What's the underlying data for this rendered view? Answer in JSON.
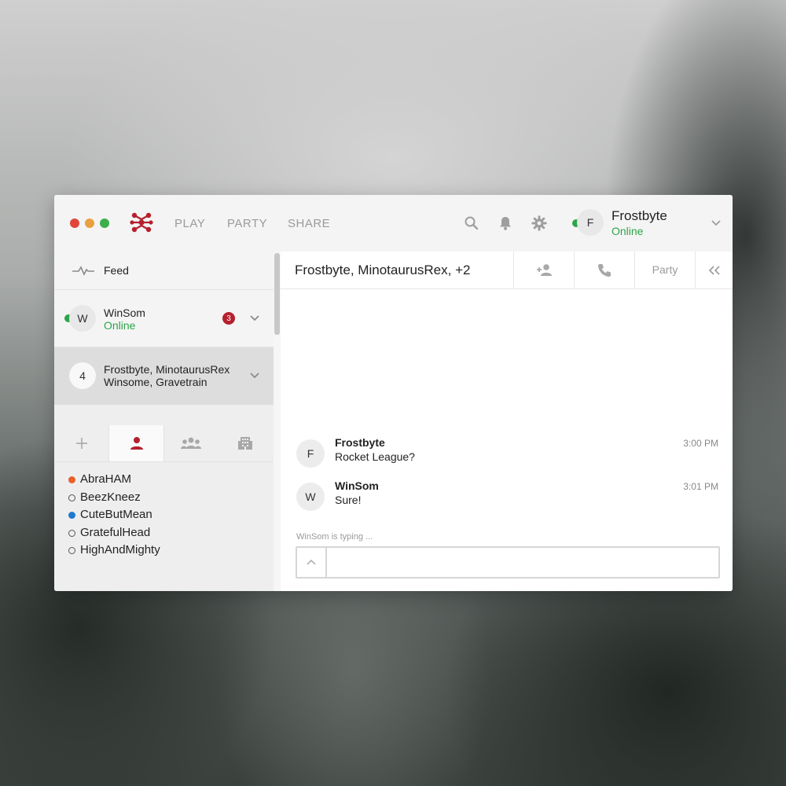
{
  "topbar": {
    "nav": {
      "play": "PLAY",
      "party": "PARTY",
      "share": "SHARE"
    },
    "profile": {
      "initial": "F",
      "name": "Frostbyte",
      "status": "Online"
    }
  },
  "sidebar": {
    "feed_label": "Feed",
    "conversations": [
      {
        "initial": "W",
        "name": "WinSom",
        "status": "Online",
        "unread": "3"
      },
      {
        "count": "4",
        "line1": "Frostbyte, MinotaurusRex",
        "line2": "Winsome, Gravetrain"
      }
    ],
    "tabs": [
      {
        "icon": "plus-icon"
      },
      {
        "icon": "person-icon",
        "active": true
      },
      {
        "icon": "group-icon"
      },
      {
        "icon": "building-icon"
      }
    ],
    "friends": [
      {
        "name": "AbraHAM",
        "presence": "away",
        "color": "#e8602a"
      },
      {
        "name": "BeezKneez",
        "presence": "offline",
        "color": "#555555"
      },
      {
        "name": "CuteButMean",
        "presence": "online",
        "color": "#1e7ad0"
      },
      {
        "name": "GratefulHead",
        "presence": "offline",
        "color": "#555555"
      },
      {
        "name": "HighAndMighty",
        "presence": "offline",
        "color": "#555555"
      }
    ]
  },
  "chat": {
    "title": "Frostbyte, MinotaurusRex, +2",
    "party_label": "Party",
    "messages": [
      {
        "initial": "F",
        "author": "Frostbyte",
        "text": "Rocket League?",
        "time": "3:00 PM"
      },
      {
        "initial": "W",
        "author": "WinSom",
        "text": "Sure!",
        "time": "3:01 PM"
      }
    ],
    "typing": "WinSom is typing ...",
    "composer_value": ""
  },
  "colors": {
    "accent": "#b5202e",
    "online": "#2ea44a",
    "away": "#e8602a",
    "busy_blue": "#1e7ad0"
  }
}
